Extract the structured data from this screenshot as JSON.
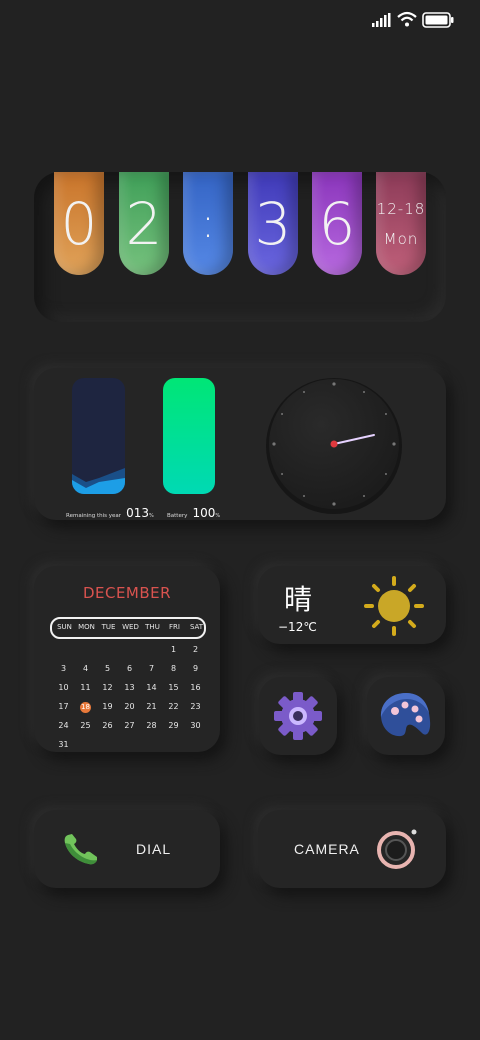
{
  "status_bar": {
    "icons": [
      "signal-icon",
      "wifi-icon",
      "battery-icon"
    ]
  },
  "clock": {
    "digits": [
      "0",
      "2",
      ":",
      "3",
      "6"
    ],
    "date": "12-18",
    "weekday": "Mon",
    "colors": [
      "#d9822f",
      "#4ab065",
      "#3e72d3",
      "#5249c9",
      "#9a45c9",
      "#b04c69"
    ]
  },
  "stats": {
    "year_caption": "Remaining this year",
    "year_value": "013",
    "year_unit": "%",
    "year_level": 0.13,
    "battery_caption": "Battery",
    "battery_value": "100",
    "battery_unit": "%",
    "battery_level": 1.0
  },
  "calendar": {
    "month": "DECEMBER",
    "weekdays": [
      "SUN",
      "MON",
      "TUE",
      "WED",
      "THU",
      "FRI",
      "SAT"
    ],
    "weeks": [
      [
        "",
        "",
        "",
        "",
        "",
        "1",
        "2"
      ],
      [
        "3",
        "4",
        "5",
        "6",
        "7",
        "8",
        "9"
      ],
      [
        "10",
        "11",
        "12",
        "13",
        "14",
        "15",
        "16"
      ],
      [
        "17",
        "18",
        "19",
        "20",
        "21",
        "22",
        "23"
      ],
      [
        "24",
        "25",
        "26",
        "27",
        "28",
        "29",
        "30"
      ],
      [
        "31",
        "",
        "",
        "",
        "",
        "",
        ""
      ]
    ],
    "today": "18"
  },
  "weather": {
    "condition": "晴",
    "temperature": "−12℃",
    "icon": "sun-icon"
  },
  "apps": {
    "settings_icon": "gear-icon",
    "theme_icon": "palette-icon"
  },
  "shortcuts": {
    "dial_label": "DIAL",
    "camera_label": "CAMERA"
  },
  "colors": {
    "background": "#222222",
    "month": "#d9534f",
    "today": "#e8793a",
    "battery_fill_top": "#00e676",
    "battery_fill_bottom": "#00d9b4"
  }
}
